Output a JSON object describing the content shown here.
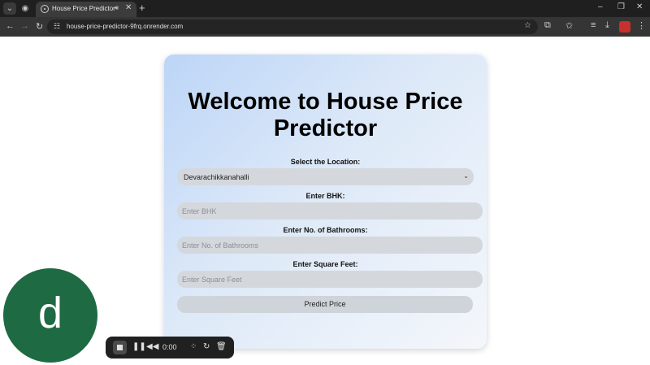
{
  "browser": {
    "tab": {
      "title": "House Price Predictor",
      "audio_icon": "speaker-icon",
      "close_icon": "close-icon"
    },
    "new_tab_label": "+",
    "window_controls": {
      "minimize": "–",
      "restore": "❐",
      "close": "✕"
    },
    "toolbar": {
      "back": "←",
      "forward": "→",
      "reload": "↻",
      "url": "house-price-predictor-9frq.onrender.com"
    }
  },
  "form": {
    "heading_line1": "Welcome to House Price",
    "heading_line2": "Predictor",
    "location_label": "Select the Location:",
    "location_value": "Devarachikkanahalli",
    "bhk_label": "Enter BHK:",
    "bhk_placeholder": "Enter BHK",
    "bath_label": "Enter No. of Bathrooms:",
    "bath_placeholder": "Enter No. of Bathrooms",
    "sqft_label": "Enter Square Feet:",
    "sqft_placeholder": "Enter Square Feet",
    "predict_label": "Predict Price"
  },
  "overlay": {
    "avatar_letter": "d",
    "avatar_color": "#1e6a43",
    "recorder": {
      "time": "0:00"
    }
  }
}
